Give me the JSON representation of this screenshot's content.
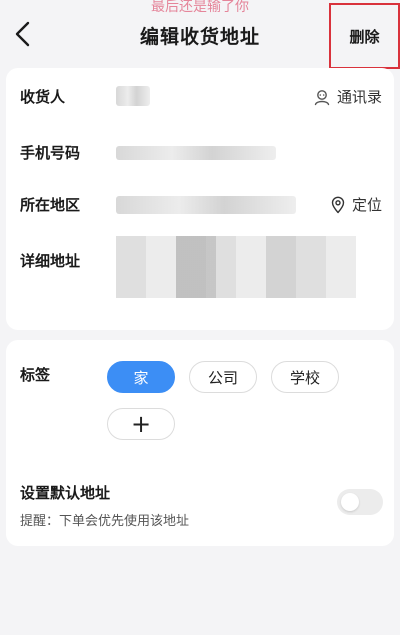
{
  "header": {
    "watermark": "最后还是输了你",
    "title": "编辑收货地址",
    "delete_label": "删除"
  },
  "form": {
    "consignee": {
      "label": "收货人",
      "action_label": "通讯录",
      "action_icon": "contact-book-icon"
    },
    "phone": {
      "label": "手机号码"
    },
    "region": {
      "label": "所在地区",
      "action_label": "定位",
      "action_icon": "location-pin-icon"
    },
    "detail": {
      "label": "详细地址"
    }
  },
  "tags": {
    "label": "标签",
    "items": [
      {
        "label": "家",
        "active": true
      },
      {
        "label": "公司",
        "active": false
      },
      {
        "label": "学校",
        "active": false
      },
      {
        "label": "+",
        "active": false
      }
    ]
  },
  "default_address": {
    "label": "设置默认地址",
    "hint": "提醒：下单会优先使用该地址",
    "enabled": false
  },
  "colors": {
    "accent": "#3c8ef5",
    "delete_highlight": "#d9323c"
  }
}
